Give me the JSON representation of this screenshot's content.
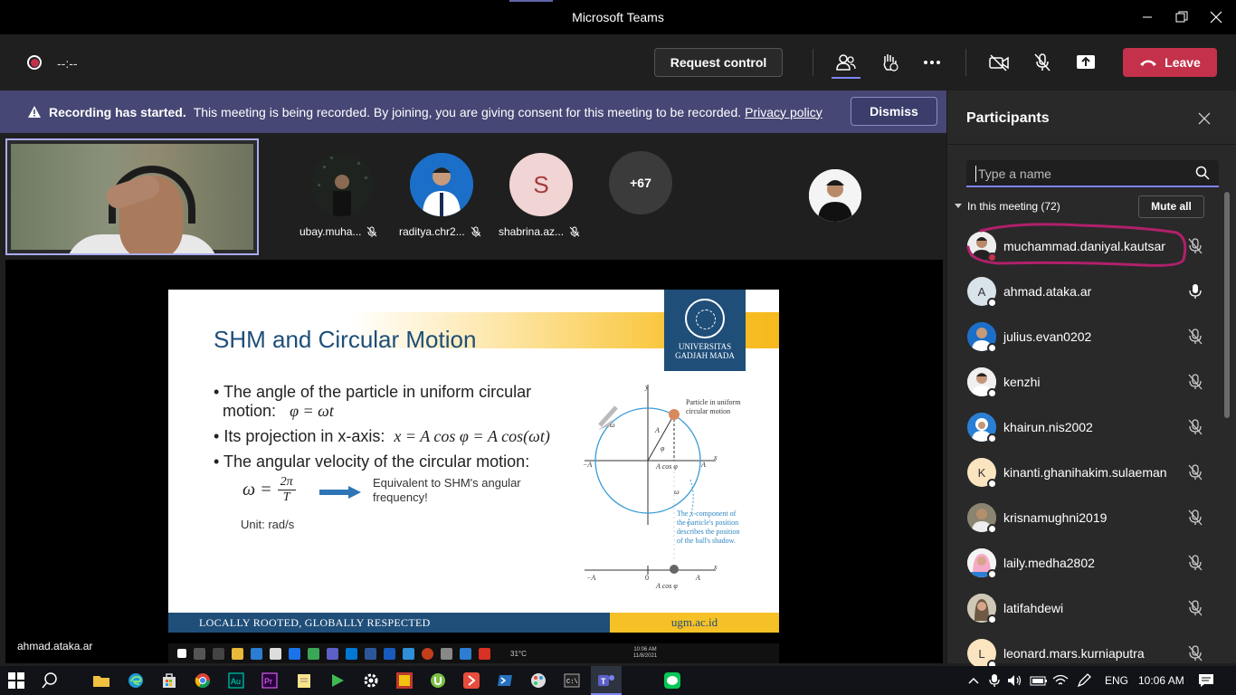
{
  "window": {
    "title": "Microsoft Teams"
  },
  "toolbar": {
    "timer": "--:--",
    "request_control": "Request control",
    "leave": "Leave"
  },
  "banner": {
    "bold": "Recording has started.",
    "text": "This meeting is being recorded. By joining, you are giving consent for this meeting to be recorded.",
    "link": "Privacy policy",
    "dismiss": "Dismiss"
  },
  "strip": {
    "tiles": [
      {
        "name": "ubay.muha..."
      },
      {
        "name": "raditya.chr2..."
      },
      {
        "name": "shabrina.az...",
        "initial": "S"
      }
    ],
    "overflow": "+67"
  },
  "presenter": "ahmad.ataka.ar",
  "slide": {
    "title": "SHM and Circular Motion",
    "logo_line1": "UNIVERSITAS",
    "logo_line2": "GADJAH MADA",
    "bullet1_a": "The angle of the particle in uniform circular",
    "bullet1_b": "motion:",
    "bullet1_eq": "φ = ωt",
    "bullet2": "Its projection in x-axis:",
    "bullet2_eq": "x = A cos φ = A cos(ωt)",
    "bullet3_a": "The",
    "bullet3_b": "angular velocity",
    "bullet3_c": "of the circular motion:",
    "omega": "ω =",
    "omega_num": "2π",
    "omega_den": "T",
    "equiv": "Equivalent to SHM's angular frequency!",
    "unit": "Unit: rad/s",
    "footer_left": "LOCALLY ROOTED, GLOBALLY RESPECTED",
    "footer_right": "ugm.ac.id",
    "diagram": {
      "label_particle": "Particle in uniform",
      "label_particle2": "circular motion",
      "label_note1": "The x-component of",
      "label_note2": "the particle's position",
      "label_note3": "describes the position",
      "label_note4": "of the ball's shadow.",
      "y": "y",
      "x": "x",
      "A": "A",
      "negA": "−A",
      "phi": "φ",
      "omega": "ω",
      "Acos": "A cos φ",
      "zero": "0"
    },
    "taskbar": {
      "temp": "31°C",
      "time": "10:06 AM",
      "date": "11/8/2021"
    }
  },
  "participants": {
    "title": "Participants",
    "search_placeholder": "Type a name",
    "section": "In this meeting (72)",
    "mute_all": "Mute all",
    "list": [
      {
        "name": "muchammad.daniyal.kautsar",
        "mic": "muted"
      },
      {
        "name": "ahmad.ataka.ar",
        "mic": "on",
        "initial": "A"
      },
      {
        "name": "julius.evan0202",
        "mic": "muted"
      },
      {
        "name": "kenzhi",
        "mic": "muted"
      },
      {
        "name": "khairun.nis2002",
        "mic": "muted"
      },
      {
        "name": "kinanti.ghanihakim.sulaeman",
        "mic": "muted",
        "initial": "K"
      },
      {
        "name": "krisnamughni2019",
        "mic": "muted"
      },
      {
        "name": "laily.medha2802",
        "mic": "muted"
      },
      {
        "name": "latifahdewi",
        "mic": "muted"
      },
      {
        "name": "leonard.mars.kurniaputra",
        "mic": "muted",
        "initial": "L"
      }
    ]
  },
  "taskbar": {
    "lang": "ENG",
    "time": "10:06 AM"
  },
  "colors": {
    "accent": "#7f85f5",
    "leave": "#c4314b",
    "banner": "#464775",
    "annotation": "#b0206a"
  }
}
